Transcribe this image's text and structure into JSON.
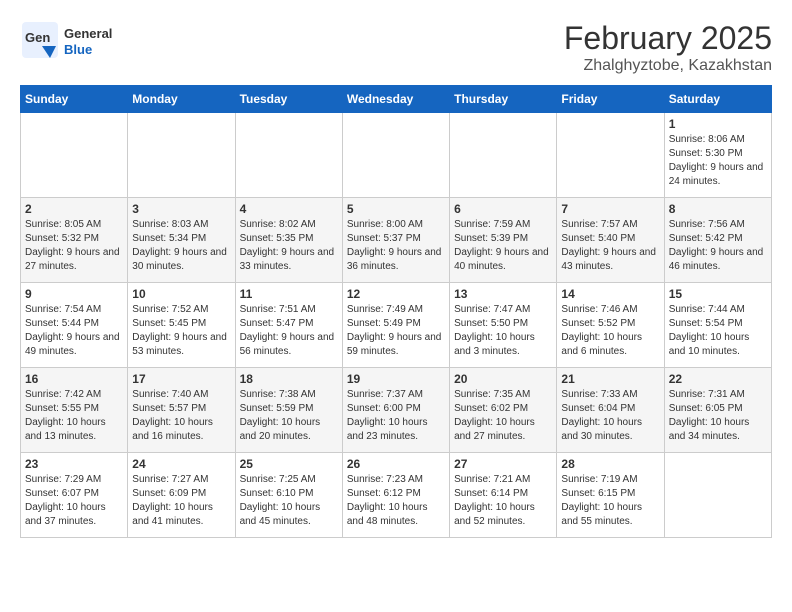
{
  "logo": {
    "general": "General",
    "blue": "Blue"
  },
  "header": {
    "title": "February 2025",
    "subtitle": "Zhalghyztobe, Kazakhstan"
  },
  "calendar": {
    "weekdays": [
      "Sunday",
      "Monday",
      "Tuesday",
      "Wednesday",
      "Thursday",
      "Friday",
      "Saturday"
    ],
    "rows": [
      [
        {
          "day": "",
          "info": ""
        },
        {
          "day": "",
          "info": ""
        },
        {
          "day": "",
          "info": ""
        },
        {
          "day": "",
          "info": ""
        },
        {
          "day": "",
          "info": ""
        },
        {
          "day": "",
          "info": ""
        },
        {
          "day": "1",
          "info": "Sunrise: 8:06 AM\nSunset: 5:30 PM\nDaylight: 9 hours and 24 minutes."
        }
      ],
      [
        {
          "day": "2",
          "info": "Sunrise: 8:05 AM\nSunset: 5:32 PM\nDaylight: 9 hours and 27 minutes."
        },
        {
          "day": "3",
          "info": "Sunrise: 8:03 AM\nSunset: 5:34 PM\nDaylight: 9 hours and 30 minutes."
        },
        {
          "day": "4",
          "info": "Sunrise: 8:02 AM\nSunset: 5:35 PM\nDaylight: 9 hours and 33 minutes."
        },
        {
          "day": "5",
          "info": "Sunrise: 8:00 AM\nSunset: 5:37 PM\nDaylight: 9 hours and 36 minutes."
        },
        {
          "day": "6",
          "info": "Sunrise: 7:59 AM\nSunset: 5:39 PM\nDaylight: 9 hours and 40 minutes."
        },
        {
          "day": "7",
          "info": "Sunrise: 7:57 AM\nSunset: 5:40 PM\nDaylight: 9 hours and 43 minutes."
        },
        {
          "day": "8",
          "info": "Sunrise: 7:56 AM\nSunset: 5:42 PM\nDaylight: 9 hours and 46 minutes."
        }
      ],
      [
        {
          "day": "9",
          "info": "Sunrise: 7:54 AM\nSunset: 5:44 PM\nDaylight: 9 hours and 49 minutes."
        },
        {
          "day": "10",
          "info": "Sunrise: 7:52 AM\nSunset: 5:45 PM\nDaylight: 9 hours and 53 minutes."
        },
        {
          "day": "11",
          "info": "Sunrise: 7:51 AM\nSunset: 5:47 PM\nDaylight: 9 hours and 56 minutes."
        },
        {
          "day": "12",
          "info": "Sunrise: 7:49 AM\nSunset: 5:49 PM\nDaylight: 9 hours and 59 minutes."
        },
        {
          "day": "13",
          "info": "Sunrise: 7:47 AM\nSunset: 5:50 PM\nDaylight: 10 hours and 3 minutes."
        },
        {
          "day": "14",
          "info": "Sunrise: 7:46 AM\nSunset: 5:52 PM\nDaylight: 10 hours and 6 minutes."
        },
        {
          "day": "15",
          "info": "Sunrise: 7:44 AM\nSunset: 5:54 PM\nDaylight: 10 hours and 10 minutes."
        }
      ],
      [
        {
          "day": "16",
          "info": "Sunrise: 7:42 AM\nSunset: 5:55 PM\nDaylight: 10 hours and 13 minutes."
        },
        {
          "day": "17",
          "info": "Sunrise: 7:40 AM\nSunset: 5:57 PM\nDaylight: 10 hours and 16 minutes."
        },
        {
          "day": "18",
          "info": "Sunrise: 7:38 AM\nSunset: 5:59 PM\nDaylight: 10 hours and 20 minutes."
        },
        {
          "day": "19",
          "info": "Sunrise: 7:37 AM\nSunset: 6:00 PM\nDaylight: 10 hours and 23 minutes."
        },
        {
          "day": "20",
          "info": "Sunrise: 7:35 AM\nSunset: 6:02 PM\nDaylight: 10 hours and 27 minutes."
        },
        {
          "day": "21",
          "info": "Sunrise: 7:33 AM\nSunset: 6:04 PM\nDaylight: 10 hours and 30 minutes."
        },
        {
          "day": "22",
          "info": "Sunrise: 7:31 AM\nSunset: 6:05 PM\nDaylight: 10 hours and 34 minutes."
        }
      ],
      [
        {
          "day": "23",
          "info": "Sunrise: 7:29 AM\nSunset: 6:07 PM\nDaylight: 10 hours and 37 minutes."
        },
        {
          "day": "24",
          "info": "Sunrise: 7:27 AM\nSunset: 6:09 PM\nDaylight: 10 hours and 41 minutes."
        },
        {
          "day": "25",
          "info": "Sunrise: 7:25 AM\nSunset: 6:10 PM\nDaylight: 10 hours and 45 minutes."
        },
        {
          "day": "26",
          "info": "Sunrise: 7:23 AM\nSunset: 6:12 PM\nDaylight: 10 hours and 48 minutes."
        },
        {
          "day": "27",
          "info": "Sunrise: 7:21 AM\nSunset: 6:14 PM\nDaylight: 10 hours and 52 minutes."
        },
        {
          "day": "28",
          "info": "Sunrise: 7:19 AM\nSunset: 6:15 PM\nDaylight: 10 hours and 55 minutes."
        },
        {
          "day": "",
          "info": ""
        }
      ]
    ]
  }
}
